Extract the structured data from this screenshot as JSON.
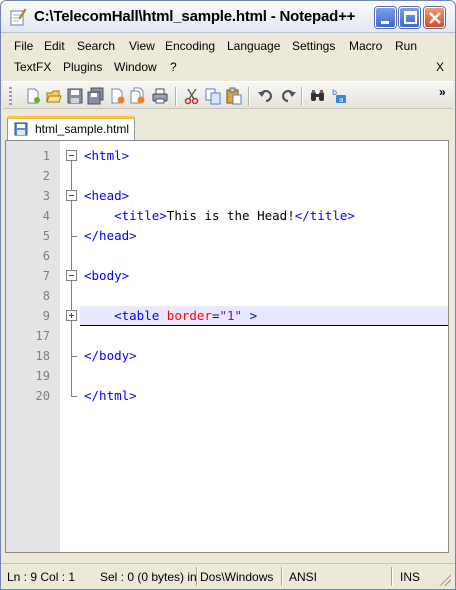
{
  "window": {
    "title": "C:\\TelecomHall\\html_sample.html - Notepad++"
  },
  "menu": {
    "row1": [
      {
        "label": "File",
        "name": "menu-file"
      },
      {
        "label": "Edit",
        "name": "menu-edit"
      },
      {
        "label": "Search",
        "name": "menu-search"
      },
      {
        "label": "View",
        "name": "menu-view"
      },
      {
        "label": "Encoding",
        "name": "menu-encoding"
      },
      {
        "label": "Language",
        "name": "menu-language"
      },
      {
        "label": "Settings",
        "name": "menu-settings"
      },
      {
        "label": "Macro",
        "name": "menu-macro"
      },
      {
        "label": "Run",
        "name": "menu-run"
      }
    ],
    "row2": [
      {
        "label": "TextFX",
        "name": "menu-textfx"
      },
      {
        "label": "Plugins",
        "name": "menu-plugins"
      },
      {
        "label": "Window",
        "name": "menu-window"
      },
      {
        "label": "?",
        "name": "menu-help"
      }
    ],
    "close_doc": "X"
  },
  "toolbar": {
    "icons": [
      "new-file-icon",
      "open-file-icon",
      "save-icon",
      "save-all-icon",
      "close-icon",
      "close-all-icon",
      "print-icon",
      "cut-icon",
      "copy-icon",
      "paste-icon",
      "undo-icon",
      "redo-icon",
      "find-icon",
      "replace-icon"
    ],
    "overflow": "»"
  },
  "tabs": [
    {
      "label": "html_sample.html",
      "active": true
    }
  ],
  "editor": {
    "current_line": "9",
    "lines": [
      {
        "num": "1",
        "segments": [
          {
            "t": "<html>",
            "c": "tag"
          }
        ]
      },
      {
        "num": "2",
        "segments": []
      },
      {
        "num": "3",
        "segments": [
          {
            "t": "<head>",
            "c": "tag"
          }
        ]
      },
      {
        "num": "4",
        "segments": [
          {
            "t": "    ",
            "c": "txt"
          },
          {
            "t": "<title>",
            "c": "tag"
          },
          {
            "t": "This is the Head!",
            "c": "txt"
          },
          {
            "t": "</title>",
            "c": "tag"
          }
        ]
      },
      {
        "num": "5",
        "segments": [
          {
            "t": "</head>",
            "c": "tag"
          }
        ]
      },
      {
        "num": "6",
        "segments": []
      },
      {
        "num": "7",
        "segments": [
          {
            "t": "<body>",
            "c": "tag"
          }
        ]
      },
      {
        "num": "8",
        "segments": []
      },
      {
        "num": "9",
        "segments": [
          {
            "t": "    ",
            "c": "txt"
          },
          {
            "t": "<table ",
            "c": "tag"
          },
          {
            "t": "border",
            "c": "attr"
          },
          {
            "t": "=",
            "c": "tag"
          },
          {
            "t": "\"1\"",
            "c": "val"
          },
          {
            "t": " >",
            "c": "tag"
          }
        ]
      },
      {
        "num": "17",
        "segments": []
      },
      {
        "num": "18",
        "segments": [
          {
            "t": "</body>",
            "c": "tag"
          }
        ]
      },
      {
        "num": "19",
        "segments": []
      },
      {
        "num": "20",
        "segments": [
          {
            "t": "</html>",
            "c": "tag"
          }
        ]
      }
    ]
  },
  "statusbar": {
    "position": "Ln : 9    Col : 1",
    "selection": "Sel : 0 (0 bytes) in",
    "eol": "Dos\\Windows",
    "encoding": "ANSI",
    "mode": "INS"
  },
  "colors": {
    "tag": "#0000ff",
    "attribute": "#ff0000",
    "value": "#8000ff",
    "gutter": "#e4e4e4",
    "current_line": "#e8e8ff"
  }
}
